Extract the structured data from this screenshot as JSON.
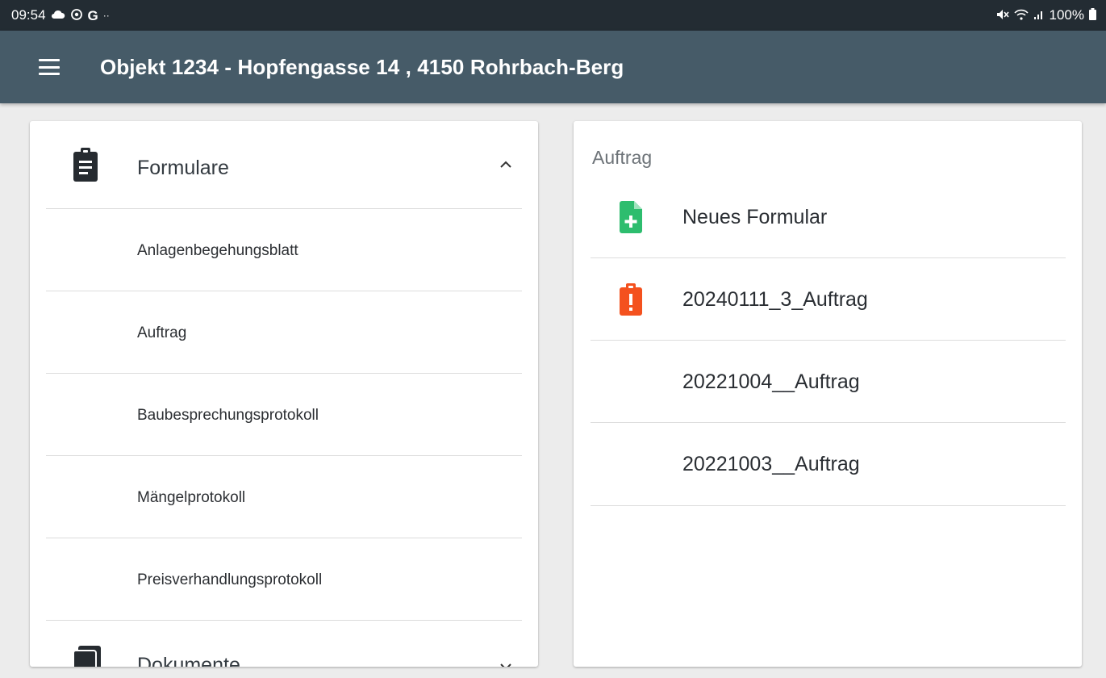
{
  "status_bar": {
    "time": "09:54",
    "left_icons": [
      "cloud-icon",
      "sync-icon",
      "google-icon",
      "more-notifications-icon"
    ],
    "battery": "100%",
    "right_icons": [
      "mute-icon",
      "wifi-icon",
      "signal-icon",
      "battery-icon"
    ]
  },
  "app_bar": {
    "title": "Objekt 1234 - Hopfengasse 14 , 4150 Rohrbach-Berg",
    "menu_icon": "menu-icon"
  },
  "left_panel": {
    "section": {
      "label": "Formulare",
      "icon": "clipboard-icon",
      "expanded": true
    },
    "items": [
      {
        "label": "Anlagenbegehungsblatt"
      },
      {
        "label": "Auftrag"
      },
      {
        "label": "Baubesprechungsprotokoll"
      },
      {
        "label": "Mängelprotokoll"
      },
      {
        "label": "Preisverhandlungsprotokoll"
      }
    ],
    "section2": {
      "label": "Dokumente",
      "icon": "documents-icon",
      "expanded": false
    }
  },
  "right_panel": {
    "title": "Auftrag",
    "items": [
      {
        "label": "Neues Formular",
        "icon": "new-document-icon",
        "color": "#2dbd6e"
      },
      {
        "label": "20240111_3_Auftrag",
        "icon": "alert-clipboard-icon",
        "color": "#f4511e"
      },
      {
        "label": "20221004__Auftrag",
        "icon": "",
        "color": ""
      },
      {
        "label": "20221003__Auftrag",
        "icon": "",
        "color": ""
      }
    ]
  },
  "colors": {
    "status_bar_bg": "#232c33",
    "app_bar_bg": "#465b68",
    "page_bg": "#ececec",
    "green": "#2dbd6e",
    "orange": "#f4511e"
  }
}
